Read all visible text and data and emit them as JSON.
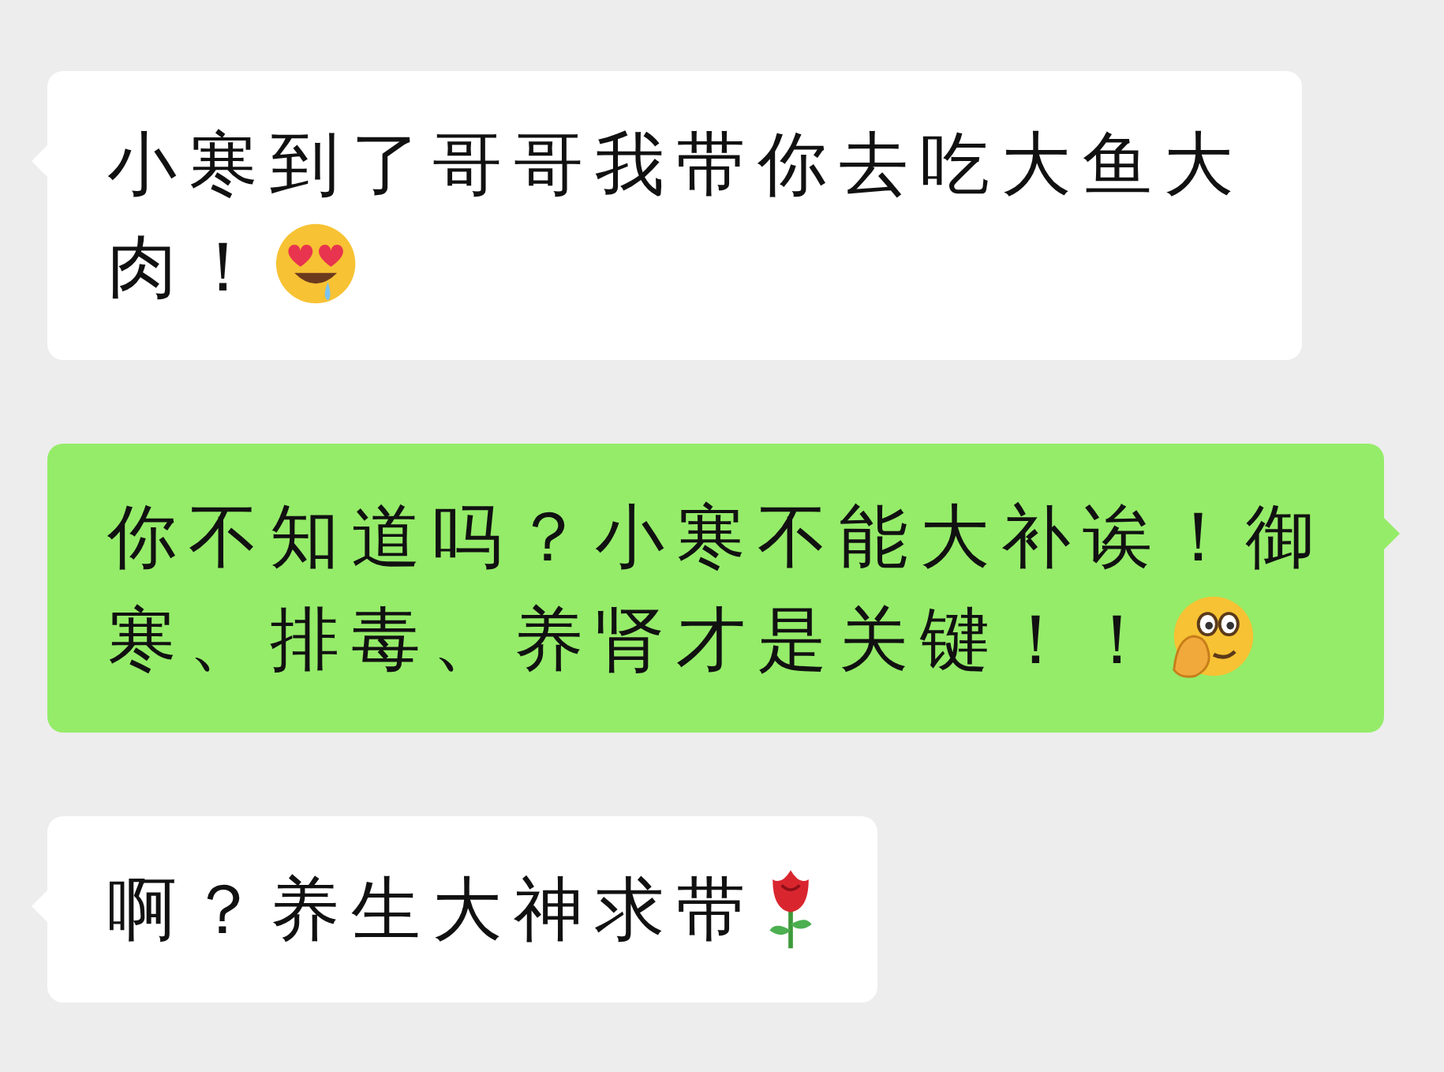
{
  "messages": [
    {
      "kind": "received",
      "lines": [
        "小寒到了哥哥我带你去吃大鱼大",
        "肉！"
      ],
      "sticker": {
        "kind": "hearteyes"
      }
    },
    {
      "kind": "sent",
      "lines": [
        "你不知道吗？小寒不能大补诶！御",
        "寒、排毒、养肾才是关键！！"
      ],
      "sticker": {
        "kind": "peeking"
      }
    },
    {
      "kind": "received",
      "lines": [
        "啊？养生大神求带"
      ],
      "sticker": {
        "kind": "rose"
      }
    }
  ]
}
